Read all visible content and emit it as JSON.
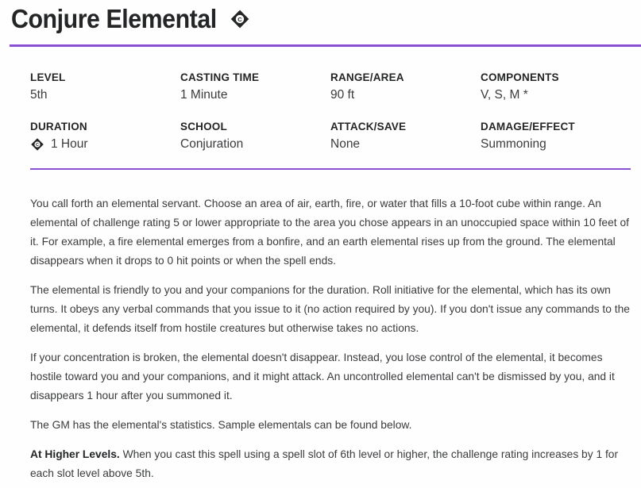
{
  "spell": {
    "name": "Conjure Elemental",
    "icon": "concentration-icon"
  },
  "stats": [
    {
      "label": "LEVEL",
      "value": "5th"
    },
    {
      "label": "CASTING TIME",
      "value": "1 Minute"
    },
    {
      "label": "RANGE/AREA",
      "value": "90 ft"
    },
    {
      "label": "COMPONENTS",
      "value": "V, S, M *"
    },
    {
      "label": "DURATION",
      "value": "1 Hour",
      "icon": "concentration-icon"
    },
    {
      "label": "SCHOOL",
      "value": "Conjuration"
    },
    {
      "label": "ATTACK/SAVE",
      "value": "None"
    },
    {
      "label": "DAMAGE/EFFECT",
      "value": "Summoning"
    }
  ],
  "description": {
    "paragraphs": [
      "You call forth an elemental servant. Choose an area of air, earth, fire, or water that fills a 10-foot cube within range. An elemental of challenge rating 5 or lower appropriate to the area you chose appears in an unoccupied space within 10 feet of it. For example, a fire elemental emerges from a bonfire, and an earth elemental rises up from the ground. The elemental disappears when it drops to 0 hit points or when the spell ends.",
      "The elemental is friendly to you and your companions for the duration. Roll initiative for the elemental, which has its own turns. It obeys any verbal commands that you issue to it (no action required by you). If you don't issue any commands to the elemental, it defends itself from hostile creatures but otherwise takes no actions.",
      "If your concentration is broken, the elemental doesn't disappear. Instead, you lose control of the elemental, it becomes hostile toward you and your companions, and it might attack. An uncontrolled elemental can't be dismissed by you, and it disappears 1 hour after you summoned it.",
      "The GM has the elemental's statistics. Sample elementals can be found below."
    ],
    "higher_levels_label": "At Higher Levels.",
    "higher_levels_text": "When you cast this spell using a spell slot of 6th level or higher, the challenge rating increases by 1 for each slot level above 5th."
  },
  "colors": {
    "accent": "#8a4fd3",
    "text": "#242527"
  }
}
